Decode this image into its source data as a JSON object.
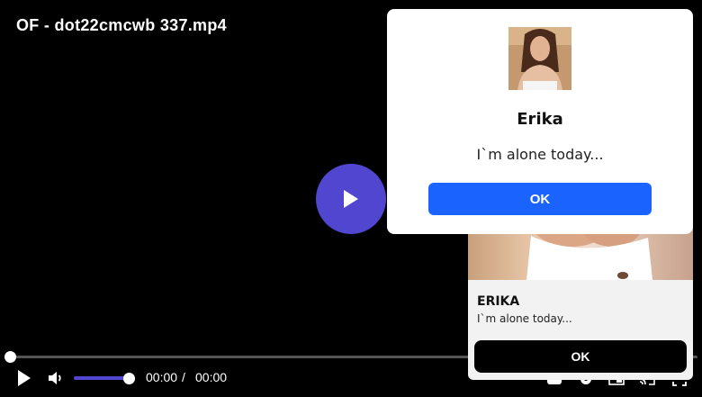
{
  "player": {
    "title": "OF - dot22cmcwb 337.mp4",
    "current_time": "00:00",
    "separator": "/",
    "total_time": "00:00",
    "progress": 0,
    "volume": 1,
    "accent_color": "#5146d0"
  },
  "notification": {
    "name": "ERIKA",
    "message": "I`m alone today...",
    "ok_label": "OK"
  },
  "modal": {
    "name": "Erika",
    "message": "I`m alone today...",
    "ok_label": "OK",
    "button_color": "#1a63ff"
  },
  "icons": {
    "big_play": "play-icon",
    "play": "play-icon",
    "mute": "volume-icon",
    "captions": "captions-icon",
    "settings": "gear-icon",
    "pip": "pip-icon",
    "cast": "cast-icon",
    "fullscreen": "fullscreen-icon"
  }
}
